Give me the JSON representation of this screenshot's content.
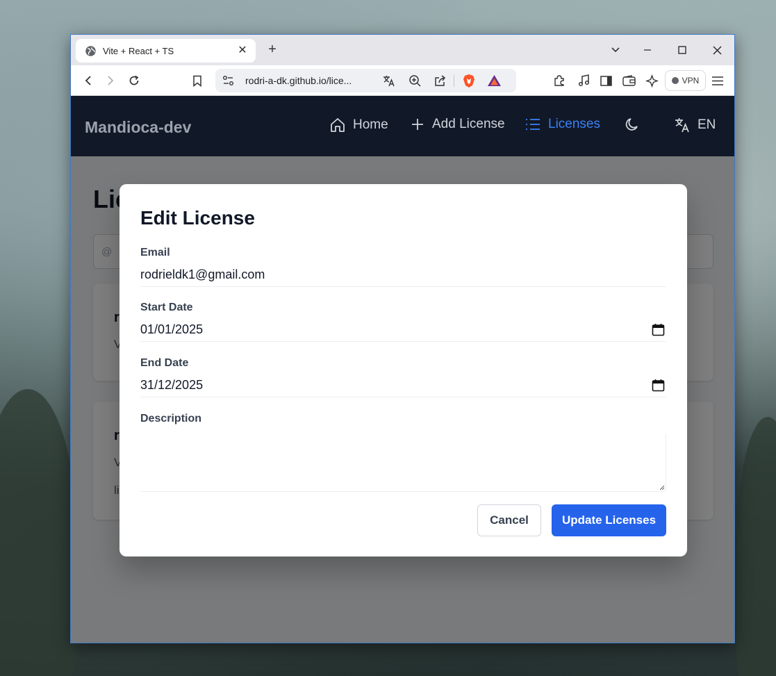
{
  "browser": {
    "tab_title": "Vite + React + TS",
    "new_tab_symbol": "+",
    "url": "rodri-a-dk.github.io/lice...",
    "vpn_label": "VPN"
  },
  "app": {
    "brand": "Mandioca-dev",
    "nav": [
      {
        "label": "Home",
        "icon": "home-icon"
      },
      {
        "label": "Add License",
        "icon": "plus-icon"
      },
      {
        "label": "Licenses",
        "icon": "list-icon",
        "active": true
      }
    ],
    "language_label": "EN",
    "accent_color": "#3b82f6"
  },
  "background_page": {
    "title_partial": "Lic",
    "search_prefix": "@",
    "cards": [
      {
        "heading_partial": "r",
        "lines": [
          "V"
        ]
      },
      {
        "heading_partial": "r",
        "lines": [
          "V",
          "li"
        ]
      }
    ]
  },
  "modal": {
    "title": "Edit License",
    "email_label": "Email",
    "email_value": "rodrieldk1@gmail.com",
    "start_label": "Start Date",
    "start_value": "01/01/2025",
    "end_label": "End Date",
    "end_value": "31/12/2025",
    "description_label": "Description",
    "description_value": "",
    "cancel_label": "Cancel",
    "submit_label": "Update Licenses",
    "submit_color": "#2563eb"
  }
}
